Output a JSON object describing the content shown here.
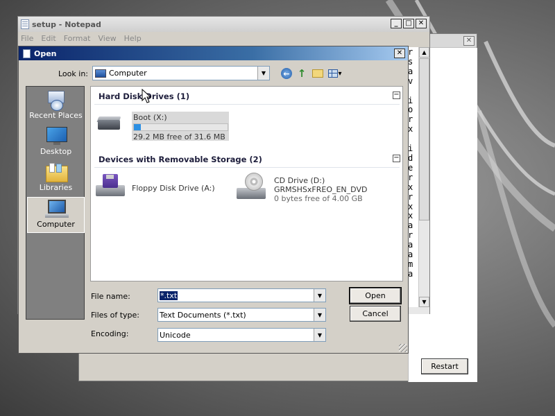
{
  "setup_dialog": {
    "close_glyph": "✕",
    "restart_label": "Restart"
  },
  "notepad": {
    "title": "setup - Notepad",
    "menu": [
      "File",
      "Edit",
      "Format",
      "View",
      "Help"
    ],
    "text_column": [
      "r",
      "s",
      "a",
      "v",
      "",
      "i",
      "o",
      "r",
      "x",
      "",
      "i",
      "d",
      "e",
      "r",
      "x",
      "r",
      "x",
      "x",
      "a",
      "r",
      "a",
      "a",
      "m",
      "a"
    ]
  },
  "open_dialog": {
    "title": "Open",
    "close_glyph": "✕",
    "look_in_label": "Look in:",
    "look_in_value": "Computer",
    "places": [
      {
        "label": "Recent Places",
        "icon": "recent-places-icon",
        "selected": false
      },
      {
        "label": "Desktop",
        "icon": "desktop-icon",
        "selected": false
      },
      {
        "label": "Libraries",
        "icon": "libraries-icon",
        "selected": false
      },
      {
        "label": "Computer",
        "icon": "computer-icon",
        "selected": true
      }
    ],
    "groups": {
      "hard_disk_header": "Hard Disk Drives (1)",
      "removable_header": "Devices with Removable Storage (2)",
      "collapse_glyph": "−"
    },
    "drives": {
      "boot": {
        "name": "Boot (X:)",
        "free_text": "29.2 MB free of 31.6 MB",
        "used_fraction": 0.076
      },
      "floppy": {
        "name": "Floppy Disk Drive (A:)"
      },
      "cd": {
        "name": "CD Drive (D:)",
        "label": "GRMSHSxFREO_EN_DVD",
        "free_text": "0 bytes free of 4.00 GB"
      }
    },
    "file_name_label": "File name:",
    "file_name_value": "*.txt",
    "files_of_type_label": "Files of type:",
    "files_of_type_value": "Text Documents (*.txt)",
    "encoding_label": "Encoding:",
    "encoding_value": "Unicode",
    "open_button": "Open",
    "cancel_button": "Cancel"
  },
  "colors": {
    "title_active_start": "#0a246a",
    "title_active_end": "#a6caf0",
    "selection": "#0a246a",
    "capacity_fill": "#2b8fe3"
  }
}
